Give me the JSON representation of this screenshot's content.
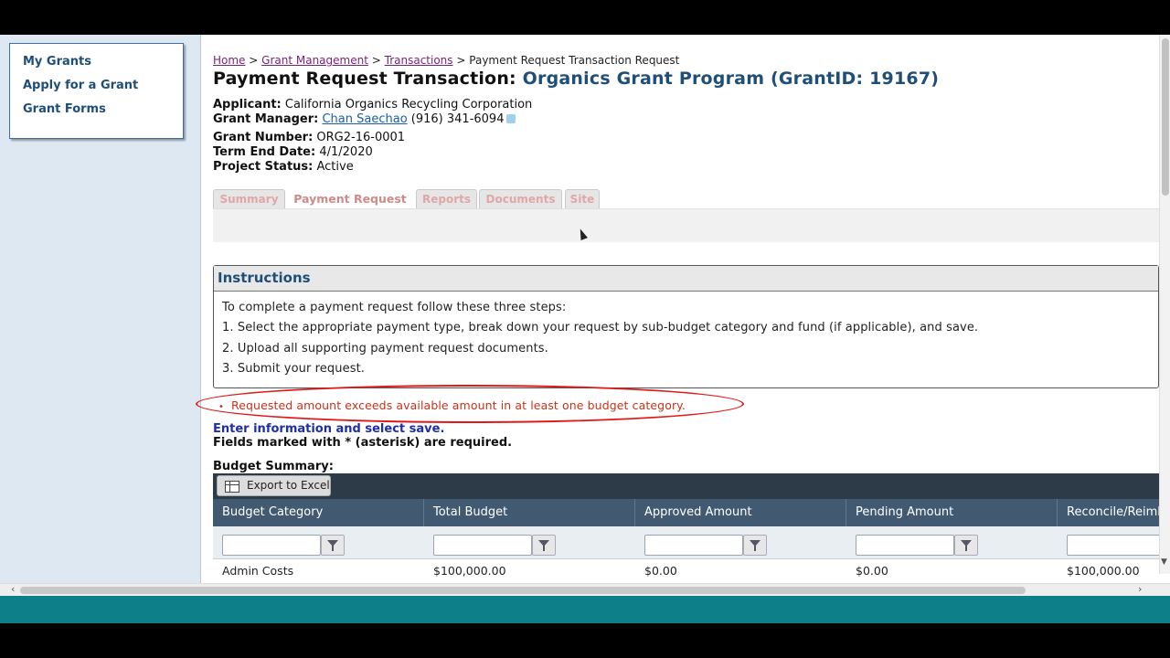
{
  "sidebar": {
    "items": [
      {
        "label": "My Grants"
      },
      {
        "label": "Apply for a Grant"
      },
      {
        "label": "Grant Forms"
      }
    ]
  },
  "breadcrumb": {
    "home": "Home",
    "sep1": ">",
    "grant_management": "Grant Management",
    "sep2": ">",
    "transactions": "Transactions",
    "sep3": ">",
    "current": "Payment Request Transaction Request"
  },
  "header": {
    "title_prefix": "Payment Request Transaction:",
    "program": "Organics Grant Program (GrantID: 19167)"
  },
  "info": {
    "applicant_label": "Applicant:",
    "applicant": "California Organics Recycling Corporation",
    "manager_label": "Grant Manager:",
    "manager": "Chan Saechao",
    "manager_phone": "(916) 341-6094",
    "grant_number_label": "Grant Number:",
    "grant_number": "ORG2-16-0001",
    "term_end_label": "Term End Date:",
    "term_end": "4/1/2020",
    "status_label": "Project Status:",
    "status": "Active"
  },
  "tabs": [
    {
      "label": "Summary"
    },
    {
      "label": "Payment Request"
    },
    {
      "label": "Reports"
    },
    {
      "label": "Documents"
    },
    {
      "label": "Site"
    }
  ],
  "instructions": {
    "heading": "Instructions",
    "intro": "To complete a payment request follow these three steps:",
    "step1": "1. Select the appropriate payment type, break down your request by sub-budget category and fund (if applicable), and save.",
    "step2": "2. Upload all supporting payment request documents.",
    "step3": "3. Submit your request."
  },
  "error": {
    "bullet": "•",
    "message": "Requested amount exceeds available amount in at least one budget category."
  },
  "form": {
    "enter_info": "Enter information and select save.",
    "required_note": "Fields marked with * (asterisk) are required.",
    "budget_summary": "Budget Summary:"
  },
  "grid": {
    "export_label": "Export to Excel",
    "columns": [
      "Budget Category",
      "Total Budget",
      "Approved Amount",
      "Pending Amount",
      "Reconcile/Reimb"
    ],
    "rows": [
      [
        "Admin Costs",
        "$100,000.00",
        "$0.00",
        "$0.00",
        "$100,000.00"
      ]
    ]
  },
  "colors": {
    "brand_blue": "#1f4e79",
    "error_red": "#e01a1a",
    "grid_header": "#415a72",
    "taskbar": "#0d7f88"
  }
}
